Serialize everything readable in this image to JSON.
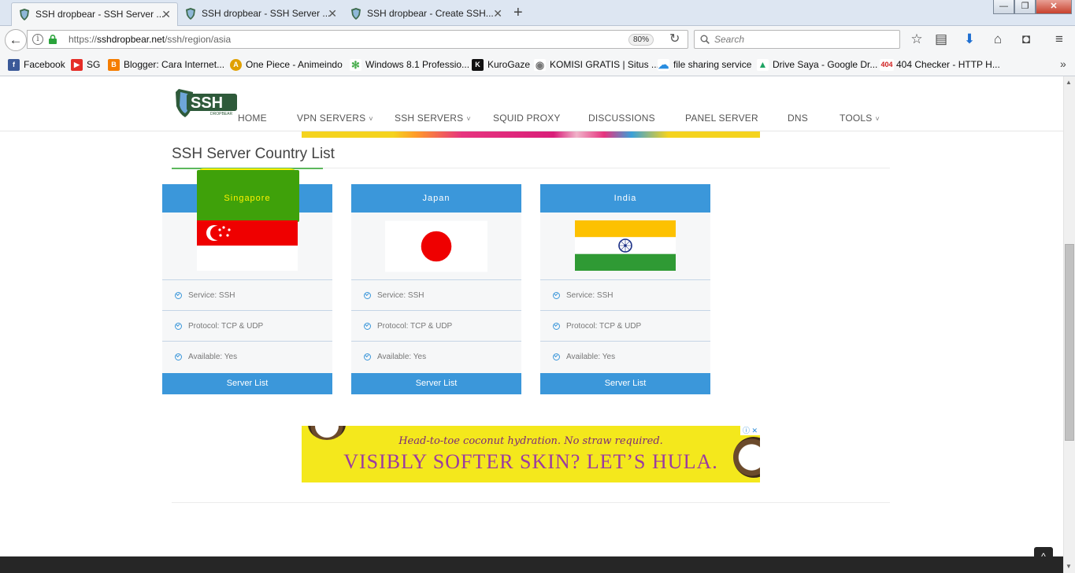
{
  "browser": {
    "tabs": [
      {
        "title": "SSH dropbear - SSH Server ...",
        "active": true
      },
      {
        "title": "SSH dropbear - SSH Server ...",
        "active": false
      },
      {
        "title": "SSH dropbear - Create SSH...",
        "active": false
      }
    ],
    "new_tab": "+",
    "window_controls": {
      "minimize": "—",
      "maximize": "❐",
      "close": "✕"
    },
    "url": {
      "prefix": "https://",
      "host": "sshdropbear.net",
      "path": "/ssh/region/asia"
    },
    "zoom": "80%",
    "search_placeholder": "Search",
    "toolbar_icons": [
      "bookmark-star-icon",
      "reading-list-icon",
      "download-icon",
      "home-icon",
      "pocket-icon",
      "menu-icon"
    ],
    "bookmarks": [
      {
        "label": "Facebook",
        "icon": "facebook-icon",
        "color": "#3b5998",
        "glyph": "f"
      },
      {
        "label": "SG",
        "icon": "youtube-icon",
        "color": "#e52d27",
        "glyph": "▶"
      },
      {
        "label": "Blogger: Cara Internet...",
        "icon": "blogger-icon",
        "color": "#f57d00",
        "glyph": "B"
      },
      {
        "label": "One Piece - Animeindo",
        "icon": "animeindo-icon",
        "color": "#e0a000",
        "glyph": "A"
      },
      {
        "label": "Windows 8.1 Professio...",
        "icon": "atom-icon",
        "color": "#4caf50",
        "glyph": "✻"
      },
      {
        "label": "KuroGaze",
        "icon": "kurogaze-icon",
        "color": "#111111",
        "glyph": "K"
      },
      {
        "label": "KOMISI GRATIS | Situs ...",
        "icon": "globe-icon",
        "color": "#777777",
        "glyph": "◉"
      },
      {
        "label": "file sharing service",
        "icon": "cloud-icon",
        "color": "#2a8ee0",
        "glyph": "☁"
      },
      {
        "label": "Drive Saya - Google Dr...",
        "icon": "google-drive-icon",
        "color": "#1fa463",
        "glyph": "▲"
      },
      {
        "label": "404 Checker - HTTP H...",
        "icon": "404-icon",
        "color": "#d01f1f",
        "glyph": "404"
      }
    ],
    "bookmarks_more": "»"
  },
  "site": {
    "logo_text": "SSH",
    "logo_subtext": "DROPBEAR",
    "menu": [
      {
        "label": "HOME",
        "dropdown": false
      },
      {
        "label": "VPN SERVERS",
        "dropdown": true
      },
      {
        "label": "SSH SERVERS",
        "dropdown": true
      },
      {
        "label": "SQUID PROXY",
        "dropdown": false
      },
      {
        "label": "DISCUSSIONS",
        "dropdown": false
      },
      {
        "label": "PANEL SERVER",
        "dropdown": false
      },
      {
        "label": "DNS",
        "dropdown": false
      },
      {
        "label": "TOOLS",
        "dropdown": true
      }
    ],
    "section_title": "SSH Server Country List",
    "cards": [
      {
        "country": "Singapore",
        "flag": "singapore-flag-icon",
        "service": "Service: SSH",
        "protocol": "Protocol: TCP & UDP",
        "available": "Available: Yes",
        "button": "Server List",
        "highlighted": true
      },
      {
        "country": "Japan",
        "flag": "japan-flag-icon",
        "service": "Service: SSH",
        "protocol": "Protocol: TCP & UDP",
        "available": "Available: Yes",
        "button": "Server List",
        "highlighted": false
      },
      {
        "country": "India",
        "flag": "india-flag-icon",
        "service": "Service: SSH",
        "protocol": "Protocol: TCP & UDP",
        "available": "Available: Yes",
        "button": "Server List",
        "highlighted": false
      }
    ],
    "ad": {
      "line1": "Head-to-toe coconut hydration. No straw required.",
      "line2": "VISIBLY SOFTER SKIN? LET’S HULA."
    },
    "colors": {
      "accent": "#3b97da",
      "highlight_green": "#3fa10a",
      "highlight_yellow": "#fff200",
      "footer": "#262626"
    }
  }
}
